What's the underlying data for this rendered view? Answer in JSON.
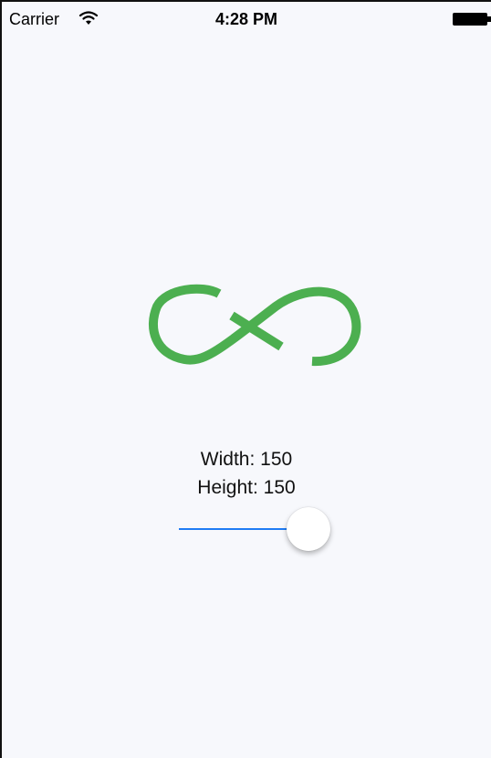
{
  "status_bar": {
    "carrier": "Carrier",
    "time": "4:28 PM",
    "wifi_icon": "wifi-icon",
    "battery_icon": "battery-icon"
  },
  "logo": {
    "icon": "infinity-logo-icon",
    "color": "#4caf50"
  },
  "size": {
    "width_label": "Width: 150",
    "height_label": "Height: 150"
  },
  "slider": {
    "value": 0.75,
    "min_track_color": "#1f7cf4"
  }
}
